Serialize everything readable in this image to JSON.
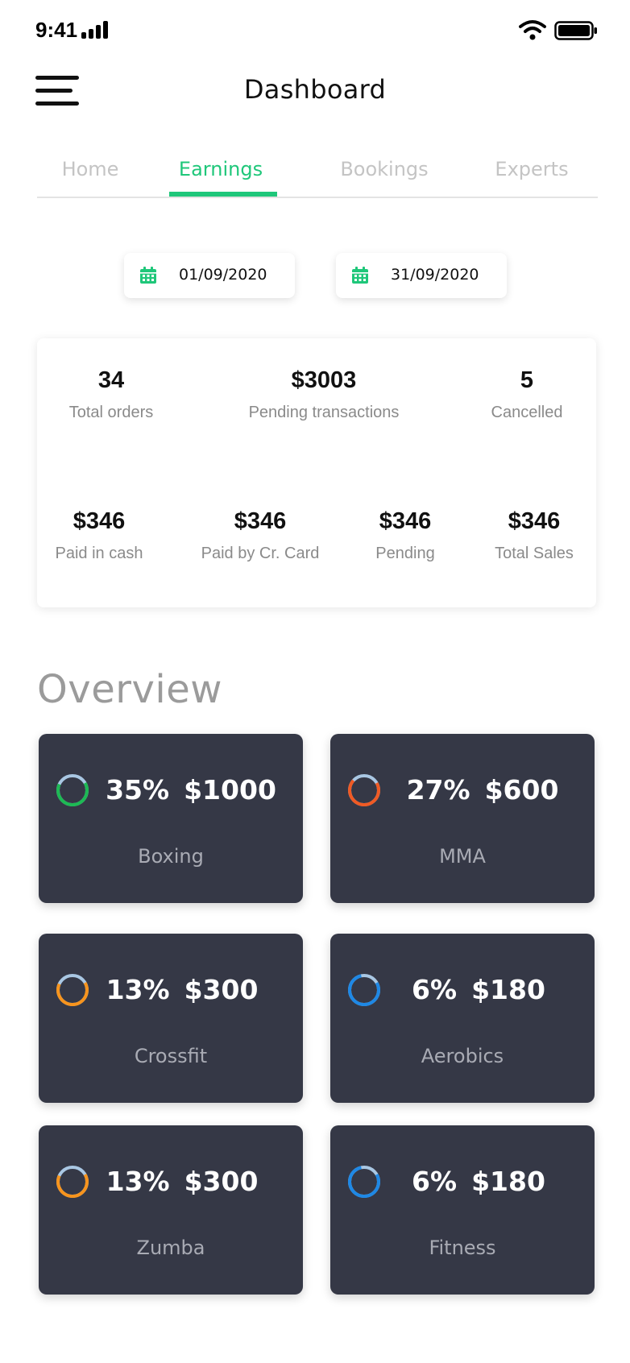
{
  "status_bar": {
    "time": "9:41"
  },
  "header": {
    "title": "Dashboard"
  },
  "tabs": [
    {
      "label": "Home",
      "active": false
    },
    {
      "label": "Earnings",
      "active": true
    },
    {
      "label": "Bookings",
      "active": false
    },
    {
      "label": "Experts",
      "active": false
    }
  ],
  "date_range": {
    "from": "01/09/2020",
    "to": "31/09/2020"
  },
  "stats": {
    "top": [
      {
        "value": "34",
        "label": "Total orders"
      },
      {
        "value": "$3003",
        "label": "Pending transactions"
      },
      {
        "value": "5",
        "label": "Cancelled"
      }
    ],
    "bottom": [
      {
        "value": "$346",
        "label": "Paid in cash"
      },
      {
        "value": "$346",
        "label": "Paid by Cr. Card"
      },
      {
        "value": "$346",
        "label": "Pending"
      },
      {
        "value": "$346",
        "label": "Total Sales"
      }
    ]
  },
  "overview": {
    "title": "Overview",
    "cards": [
      {
        "percent": "35%",
        "amount": "$1000",
        "name": "Boxing",
        "ring_color": "#1db954",
        "ring_fraction": 0.65
      },
      {
        "percent": "27%",
        "amount": "$600",
        "name": "MMA",
        "ring_color": "#f05a24",
        "ring_fraction": 0.7
      },
      {
        "percent": "13%",
        "amount": "$300",
        "name": "Crossfit",
        "ring_color": "#f7941d",
        "ring_fraction": 0.65
      },
      {
        "percent": "6%",
        "amount": "$180",
        "name": "Aerobics",
        "ring_color": "#1e88e5",
        "ring_fraction": 0.8
      },
      {
        "percent": "13%",
        "amount": "$300",
        "name": "Zumba",
        "ring_color": "#f7941d",
        "ring_fraction": 0.65
      },
      {
        "percent": "6%",
        "amount": "$180",
        "name": "Fitness",
        "ring_color": "#1e88e5",
        "ring_fraction": 0.8
      }
    ]
  },
  "colors": {
    "accent": "#1fc77a",
    "card_bg": "#353846",
    "ring_track": "#a9c7e3"
  }
}
